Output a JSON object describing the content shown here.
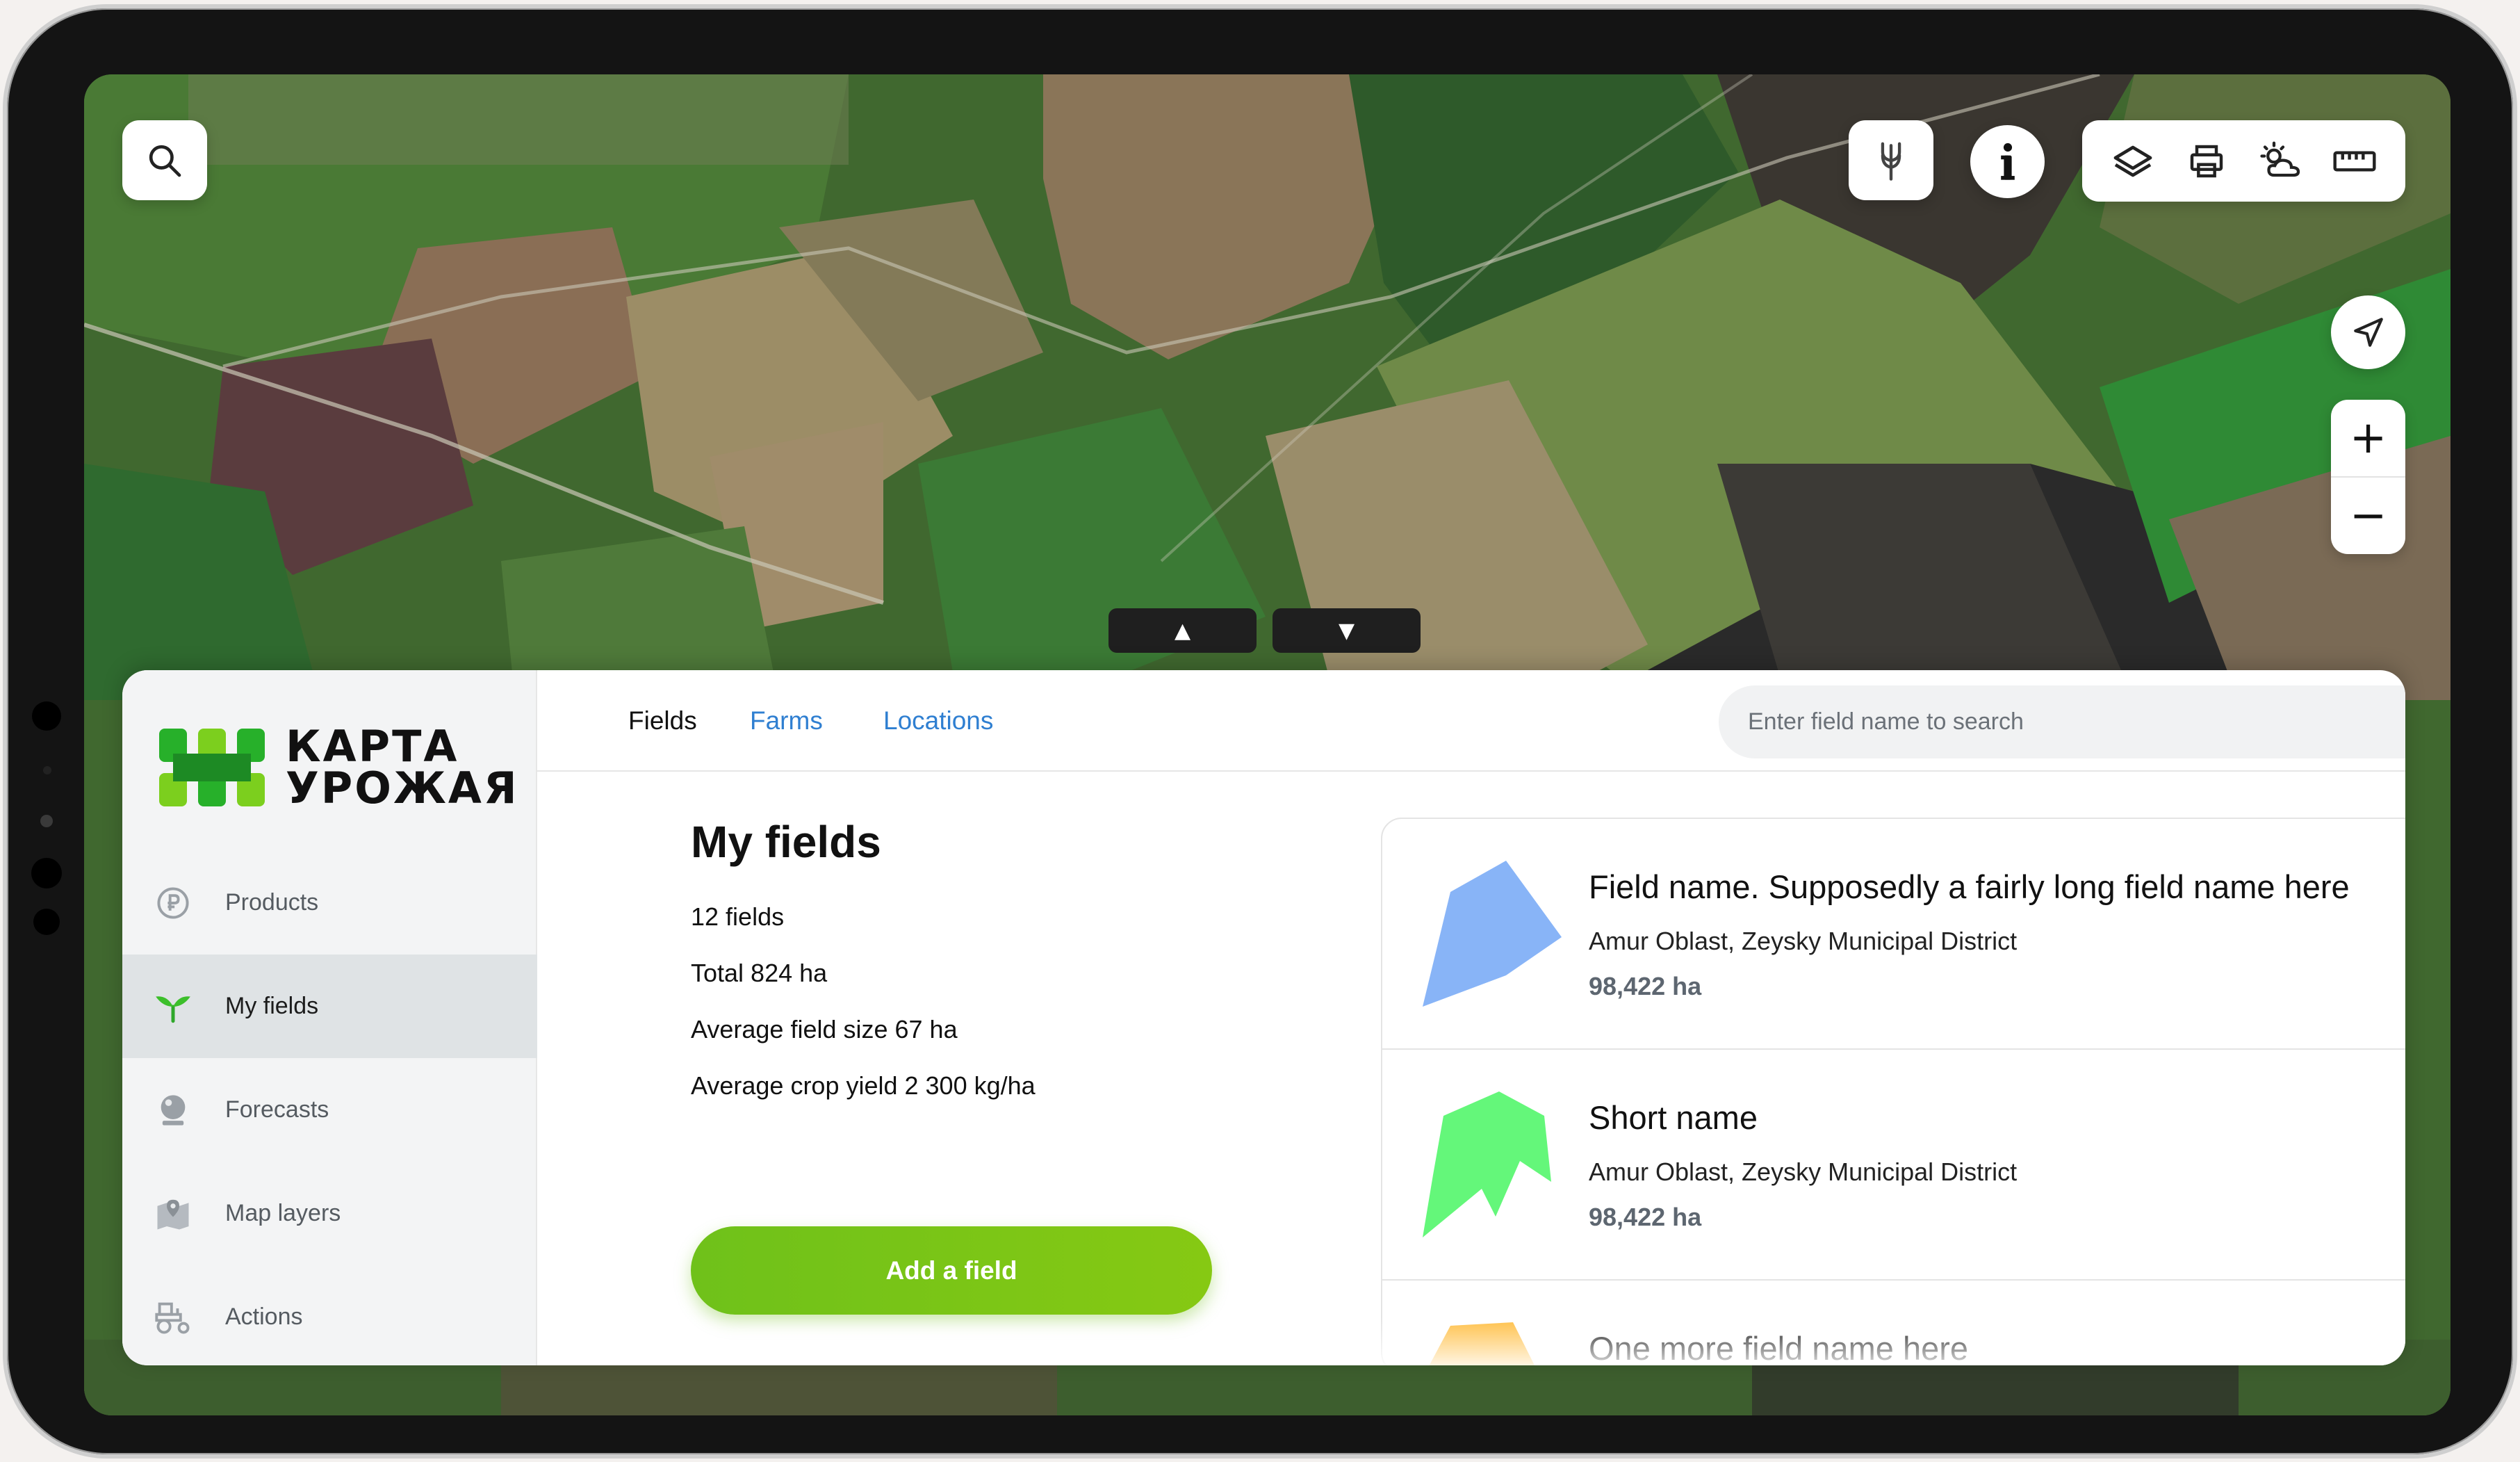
{
  "tabs": {
    "fields": "Fields",
    "farms": "Farms",
    "locations": "Locations"
  },
  "search": {
    "placeholder": "Enter field name to search"
  },
  "logo": {
    "line1": "КАРТА",
    "line2": "УРОЖАЯ"
  },
  "sidebar": {
    "items": [
      {
        "label": "Products",
        "icon": "ruble-coin-icon"
      },
      {
        "label": "My fields",
        "icon": "sprout-icon",
        "active": true
      },
      {
        "label": "Forecasts",
        "icon": "crystal-ball-icon"
      },
      {
        "label": "Map layers",
        "icon": "map-pin-icon"
      },
      {
        "label": "Actions",
        "icon": "tractor-icon"
      }
    ]
  },
  "summary": {
    "title": "My fields",
    "count": "12 fields",
    "total": "Total 824 ha",
    "avg_size": "Average field size 67 ha",
    "avg_yield": "Average crop yield 2 300 kg/ha"
  },
  "add_button": "Add a field",
  "fields": [
    {
      "name": "Field name. Supposedly a fairly long field name here",
      "region": "Amur Oblast, Zeysky Municipal District",
      "area": "98,422 ha",
      "color": "#88b4f7"
    },
    {
      "name": "Short name",
      "region": "Amur Oblast, Zeysky Municipal District",
      "area": "98,422 ha",
      "color": "#64f77a"
    },
    {
      "name": "One more field name here",
      "region": "",
      "area": "",
      "color": "#ffbe42"
    }
  ],
  "map_controls": {
    "icons": [
      "search-icon",
      "wheat-icon",
      "info-icon",
      "layers-icon",
      "printer-icon",
      "weather-icon",
      "ruler-icon",
      "locate-icon",
      "zoom-in-icon",
      "zoom-out-icon"
    ],
    "zoom_in": "+",
    "zoom_out": "−",
    "pull_up": "▲",
    "pull_down": "▼"
  },
  "colors": {
    "accent_green": "#78c414",
    "link_blue": "#2f7fd1",
    "active_nav": "#dfe3e5"
  }
}
